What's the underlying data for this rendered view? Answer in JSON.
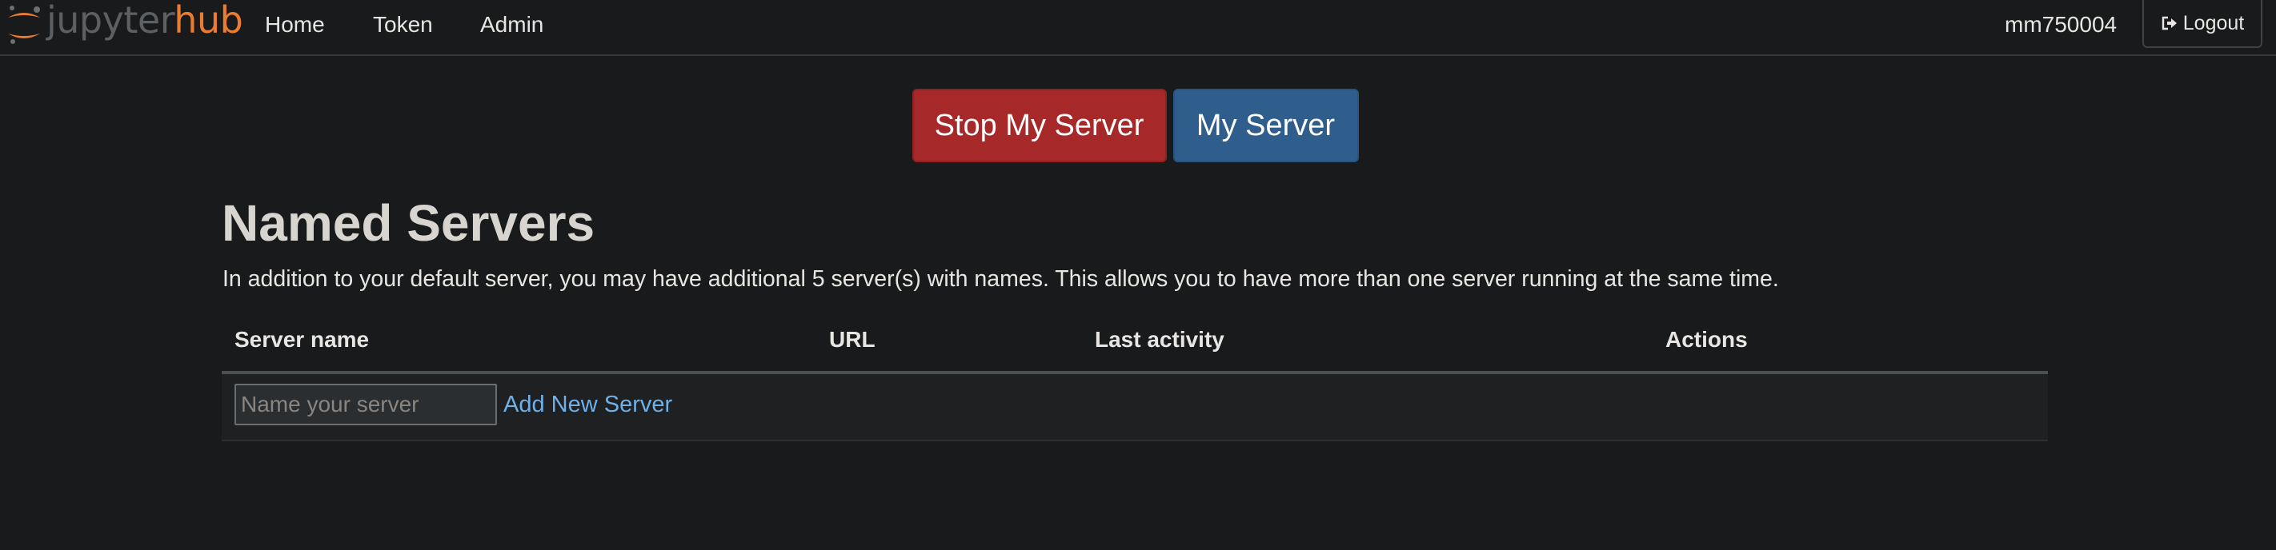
{
  "navbar": {
    "brand": {
      "part1": "jupyter",
      "part2": "hub"
    },
    "links": [
      {
        "label": "Home"
      },
      {
        "label": "Token"
      },
      {
        "label": "Admin"
      }
    ],
    "username": "mm750004",
    "logout_label": "Logout"
  },
  "server_controls": {
    "stop_label": "Stop My Server",
    "my_server_label": "My Server"
  },
  "named_servers": {
    "title": "Named Servers",
    "description": "In addition to your default server, you may have additional 5 server(s) with names. This allows you to have more than one server running at the same time.",
    "columns": [
      "Server name",
      "URL",
      "Last activity",
      "Actions"
    ],
    "new_server": {
      "placeholder": "Name your server",
      "value": "",
      "add_label": "Add New Server"
    }
  },
  "colors": {
    "background": "#181a1b",
    "danger": "#a62828",
    "primary": "#2f5d8c",
    "brand_orange": "#ea7c2f",
    "link": "#6fb0e8"
  },
  "icons": {
    "brand": "jupyter-logo-icon",
    "logout": "sign-out-icon"
  }
}
